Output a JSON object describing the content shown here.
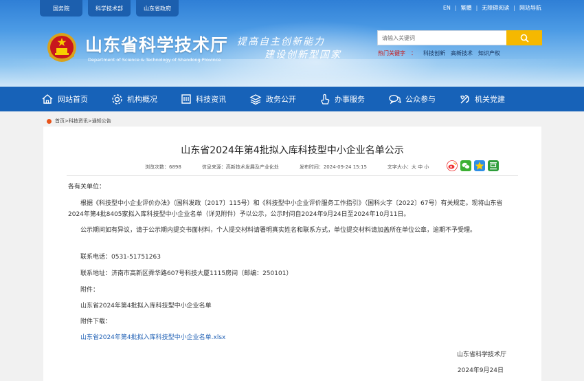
{
  "top_tabs": [
    "国务院",
    "科学技术部",
    "山东省政府"
  ],
  "top_links": [
    "EN",
    "繁體",
    "无障碍阅读",
    "网站导航"
  ],
  "site": {
    "title": "山东省科学技术厅",
    "subtitle": "Department of Science & Technology of Shandong Province",
    "slogan_line1": "提高自主创新能力",
    "slogan_line2": "建设创新型国家"
  },
  "search": {
    "placeholder": "请输入关键词",
    "hot_label": "热门关键字",
    "hot_words": [
      "科技创新",
      "高新技术",
      "知识产权"
    ]
  },
  "nav": [
    "网站首页",
    "机构概况",
    "科技资讯",
    "政务公开",
    "办事服务",
    "公众参与",
    "机关党建"
  ],
  "breadcrumb": "首页>科技资讯>通知公告",
  "article": {
    "title": "山东省2024年第4批拟入库科技型中小企业名单公示",
    "views": "浏览次数：6898",
    "source": "信息来源：高新技术发展及产业化处",
    "date": "发布时间：2024-09-24 15:15",
    "fontsize": "文字大小：大 中 小",
    "greeting": "各有关单位：",
    "para1": "根据《科技型中小企业评价办法》（国科发政〔2017〕115号）和《科技型中小企业评价服务工作指引》（国科火字〔2022〕67号）有关规定。现将山东省2024年第4批8405家拟入库科技型中小企业名单（详见附件）予以公示，公示时间自2024年9月24日至2024年10月11日。",
    "para2": "公示期间如有异议，请于公示期内提交书面材料，个人提交材料请署明真实姓名和联系方式，单位提交材料请加盖所在单位公章，逾期不予受理。",
    "phone": "联系电话：0531-51751263",
    "address": "联系地址：济南市高新区舜华路607号科技大厦1115房间（邮编：250101）",
    "attach_label": "附件：",
    "attach_name": "山东省2024年第4批拟入库科技型中小企业名单",
    "download_label": "附件下载：",
    "download_link": "山东省2024年第4批拟入库科技型中小企业名单.xlsx",
    "signature": "山东省科学技术厅",
    "sign_date": "2024年9月24日"
  },
  "colors": {
    "nav": "#1762b8",
    "accent": "#f5b800",
    "hot": "#c81414",
    "link": "#1e5fb4"
  }
}
